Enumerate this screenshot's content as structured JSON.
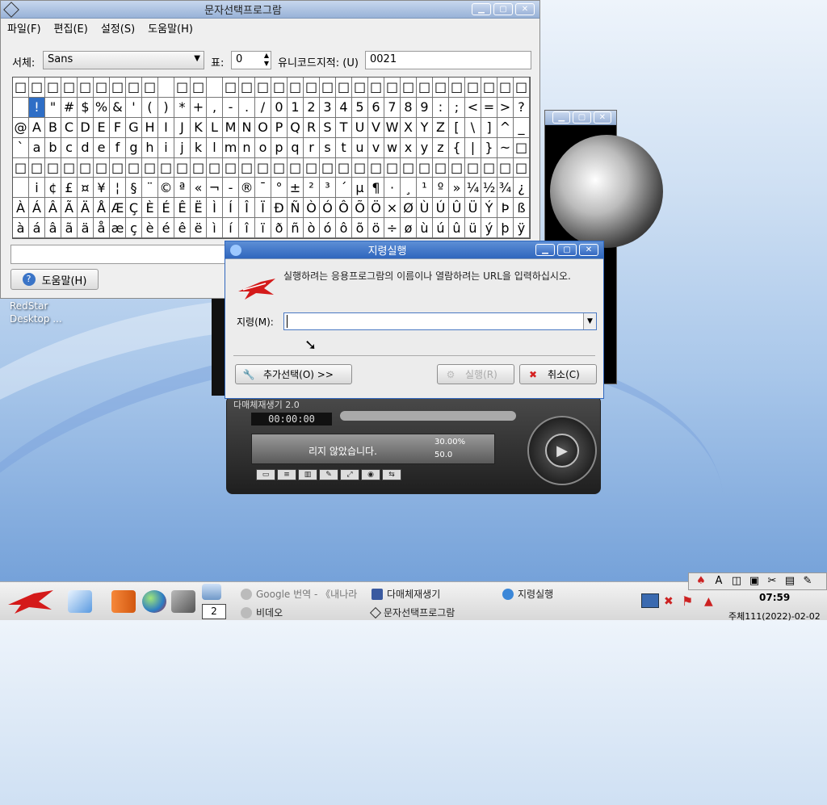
{
  "desktop": {
    "label_line1": "RedStar",
    "label_line2": "Desktop ..."
  },
  "charmap": {
    "title": "문자선택프로그람",
    "menu": [
      "파일(F)",
      "편집(E)",
      "설정(S)",
      "도움말(H)"
    ],
    "font_label": "서체:",
    "font_value": "Sans",
    "table_label": "표:",
    "table_value": "0",
    "unicode_label": "유니코드지적: (U)",
    "unicode_value": "0021",
    "help_button": "도움말(H)",
    "rows": [
      [
        "□",
        "□",
        "□",
        "□",
        "□",
        "□",
        "□",
        "□",
        "□",
        "",
        "□",
        "□",
        "",
        "□",
        "□",
        "□",
        "□",
        "□",
        "□",
        "□",
        "□",
        "□",
        "□",
        "□",
        "□",
        "□",
        "□",
        "□",
        "□",
        "□",
        "□",
        "□"
      ],
      [
        "",
        "!",
        "\"",
        "#",
        "$",
        "%",
        "&",
        "'",
        "(",
        ")",
        "*",
        "+",
        ",",
        "-",
        ".",
        "/",
        "0",
        "1",
        "2",
        "3",
        "4",
        "5",
        "6",
        "7",
        "8",
        "9",
        ":",
        ";",
        "<",
        "=",
        ">",
        "?"
      ],
      [
        "@",
        "A",
        "B",
        "C",
        "D",
        "E",
        "F",
        "G",
        "H",
        "I",
        "J",
        "K",
        "L",
        "M",
        "N",
        "O",
        "P",
        "Q",
        "R",
        "S",
        "T",
        "U",
        "V",
        "W",
        "X",
        "Y",
        "Z",
        "[",
        "\\",
        "]",
        "^",
        "_"
      ],
      [
        "`",
        "a",
        "b",
        "c",
        "d",
        "e",
        "f",
        "g",
        "h",
        "i",
        "j",
        "k",
        "l",
        "m",
        "n",
        "o",
        "p",
        "q",
        "r",
        "s",
        "t",
        "u",
        "v",
        "w",
        "x",
        "y",
        "z",
        "{",
        "|",
        "}",
        "~",
        "□"
      ],
      [
        "□",
        "□",
        "□",
        "□",
        "□",
        "□",
        "□",
        "□",
        "□",
        "□",
        "□",
        "□",
        "□",
        "□",
        "□",
        "□",
        "□",
        "□",
        "□",
        "□",
        "□",
        "□",
        "□",
        "□",
        "□",
        "□",
        "□",
        "□",
        "□",
        "□",
        "□",
        "□"
      ],
      [
        "",
        "i",
        "¢",
        "£",
        "¤",
        "¥",
        "¦",
        "§",
        "¨",
        "©",
        "ª",
        "«",
        "¬",
        "-",
        "®",
        "¯",
        "°",
        "±",
        "²",
        "³",
        "´",
        "µ",
        "¶",
        "·",
        "¸",
        "¹",
        "º",
        "»",
        "¼",
        "½",
        "¾",
        "¿"
      ],
      [
        "À",
        "Á",
        "Â",
        "Ã",
        "Ä",
        "Å",
        "Æ",
        "Ç",
        "È",
        "É",
        "Ê",
        "Ë",
        "Ì",
        "Í",
        "Î",
        "Ï",
        "Ð",
        "Ñ",
        "Ò",
        "Ó",
        "Ô",
        "Õ",
        "Ö",
        "×",
        "Ø",
        "Ù",
        "Ú",
        "Û",
        "Ü",
        "Ý",
        "Þ",
        "ß"
      ],
      [
        "à",
        "á",
        "â",
        "ã",
        "ä",
        "å",
        "æ",
        "ç",
        "è",
        "é",
        "ê",
        "ë",
        "ì",
        "í",
        "î",
        "ï",
        "ð",
        "ñ",
        "ò",
        "ó",
        "ô",
        "õ",
        "ö",
        "÷",
        "ø",
        "ù",
        "ú",
        "û",
        "ü",
        "ý",
        "þ",
        "ÿ"
      ]
    ]
  },
  "player": {
    "title": "다매체재생기 2.0",
    "time": "00:00:00",
    "message": "리지 않았습니다.",
    "volume": "30.00%",
    "balance": "50.0"
  },
  "run_dialog": {
    "title": "지령실행",
    "description": "실행하려는 응용프로그람의 이름이나 열람하려는 URL을 입력하십시오.",
    "command_label": "지령(M):",
    "command_value": "",
    "more_button": "추가선택(O) >>",
    "run_button": "실행(R)",
    "cancel_button": "취소(C)"
  },
  "taskbar": {
    "pager": "2",
    "tasks": [
      "Google 번역 - 《내나라",
      "다매체재생기",
      "지령실행",
      "비데오",
      "문자선택프로그람"
    ],
    "clock": "07:59",
    "date": "주체111(2022)-02-02"
  }
}
